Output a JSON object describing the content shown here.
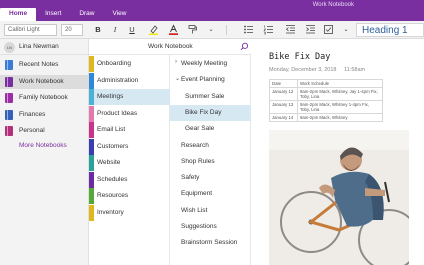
{
  "window": {
    "title": "Work Notebook"
  },
  "ribbon_tabs": [
    "Home",
    "Insert",
    "Draw",
    "View"
  ],
  "ribbon": {
    "font_name": "Calibri Light",
    "font_size": "20",
    "bold": "B",
    "italic": "I",
    "underline": "U",
    "style": "Heading 1"
  },
  "user": {
    "initials": "LN",
    "name": "Lina Newman"
  },
  "notebooks": [
    {
      "label": "Recent Notes",
      "color": "#3a7bd5"
    },
    {
      "label": "Work Notebook",
      "color": "#7a2fa0"
    },
    {
      "label": "Family Notebook",
      "color": "#9c2fa6"
    },
    {
      "label": "Finances",
      "color": "#3560b8"
    },
    {
      "label": "Personal",
      "color": "#b1327a"
    }
  ],
  "more_notebooks": "More Notebooks",
  "current_notebook": "Work Notebook",
  "sections": [
    {
      "label": "Onboarding",
      "color": "#e0b81e"
    },
    {
      "label": "Administration",
      "color": "#2f89d8"
    },
    {
      "label": "Meetings",
      "color": "#4bb2d6"
    },
    {
      "label": "Product Ideas",
      "color": "#e27ab0"
    },
    {
      "label": "Email List",
      "color": "#c8348a"
    },
    {
      "label": "Customers",
      "color": "#3a3db0"
    },
    {
      "label": "Website",
      "color": "#29a39a"
    },
    {
      "label": "Schedules",
      "color": "#6c2ba0"
    },
    {
      "label": "Resources",
      "color": "#55a83a"
    },
    {
      "label": "Inventory",
      "color": "#e0b81e"
    }
  ],
  "pages": [
    {
      "label": "Weekly Meeting",
      "level": 0,
      "chevron": "›"
    },
    {
      "label": "Event Planning",
      "level": 0,
      "chevron": "⌄"
    },
    {
      "label": "Summer Sale",
      "level": 1,
      "chevron": ""
    },
    {
      "label": "Bike Fix Day",
      "level": 1,
      "chevron": ""
    },
    {
      "label": "Gear Sale",
      "level": 1,
      "chevron": ""
    },
    {
      "label": "Research",
      "level": 0,
      "chevron": ""
    },
    {
      "label": "Shop Rules",
      "level": 0,
      "chevron": ""
    },
    {
      "label": "Safety",
      "level": 0,
      "chevron": ""
    },
    {
      "label": "Equipment",
      "level": 0,
      "chevron": ""
    },
    {
      "label": "Wish List",
      "level": 0,
      "chevron": ""
    },
    {
      "label": "Suggestions",
      "level": 0,
      "chevron": ""
    },
    {
      "label": "Brainstorm Session",
      "level": 0,
      "chevron": ""
    }
  ],
  "page": {
    "title": "Bike Fix Day",
    "date": "Monday, December 3, 2018",
    "time": "11:58am",
    "table": [
      [
        "Date",
        "Work Schedule"
      ],
      [
        "January 12",
        "9am-2pm Mack, Whitney, Jay 1-4pm Fix, Toby, Lina"
      ],
      [
        "January 13",
        "9am-2pm Mack, Whitney 1-4pm Fix, Toby, Lina"
      ],
      [
        "January 14",
        "9am-2pm Mack, Whitney"
      ]
    ]
  }
}
